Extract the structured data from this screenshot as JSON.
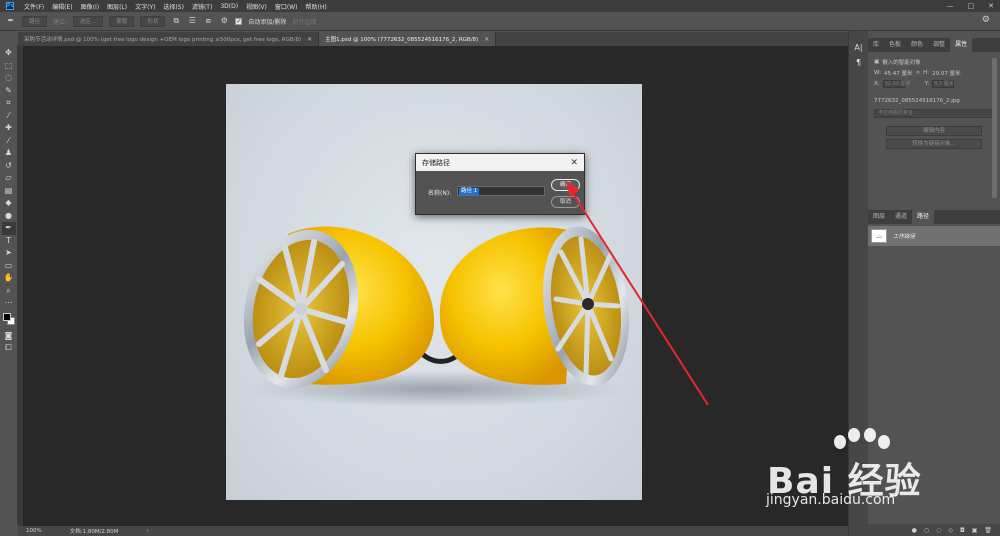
{
  "menu": {
    "logo": "Ps",
    "items": [
      "文件(F)",
      "编辑(E)",
      "图像(I)",
      "图层(L)",
      "文字(Y)",
      "选择(S)",
      "滤镜(T)",
      "3D(D)",
      "视图(V)",
      "窗口(W)",
      "帮助(H)"
    ],
    "window_controls": [
      "—",
      "□",
      "✕"
    ]
  },
  "options": {
    "path_mode": "路径",
    "make_selection": "建立:",
    "selection": "选区...",
    "mask": "蒙版",
    "shape": "形状",
    "auto_add_delete": "自动添加/删除",
    "align_edges": "对齐边缘",
    "auto_add_checked": "✓"
  },
  "tabs": [
    {
      "label": "采购节活动详情.psd @ 100% (get free logo design +OEM logo printing ≥500pcs, get free logo, RGB/8)",
      "close": "✕",
      "active": false
    },
    {
      "label": "主图1.psd @ 100% (7772632_085524516176_2, RGB/8)",
      "close": "✕",
      "active": true
    }
  ],
  "status": {
    "zoom": "100%",
    "doc": "文档:1.80M/2.80M",
    "arrow": "›"
  },
  "dialog": {
    "title": "存储路径",
    "name_label": "名称(N):",
    "name_value": "路径 1",
    "ok": "确定",
    "cancel": "取消",
    "close": "✕"
  },
  "properties_panel": {
    "tabs": [
      "库",
      "色板",
      "颜色",
      "调整",
      "属性"
    ],
    "active_tab": "属性",
    "layer_kind": "嵌入的智能对象",
    "w_label": "W:",
    "w_value": "45.47 厘米",
    "h_label": "H:",
    "h_value": "29.07 厘米",
    "x_label": "X:",
    "x_value": "32.03 厘米",
    "y_label": "Y:",
    "y_value": "8.7 厘米",
    "file_name": "7772632_085524516176_2.jpg",
    "comp_select": "不应用图层复合",
    "edit_contents": "编辑内容",
    "convert_linked": "转换为链接对象..."
  },
  "paths_panel": {
    "tabs": [
      "图层",
      "通道",
      "路径"
    ],
    "active_tab": "路径",
    "item": "工作路径"
  },
  "watermark": {
    "brand": "Bai  经验",
    "url": "jingyan.baidu.com"
  },
  "colors": {
    "accent_arrow": "#e8262c",
    "selection": "#1e6fd9",
    "speaker_yellow": "#f3c400"
  }
}
